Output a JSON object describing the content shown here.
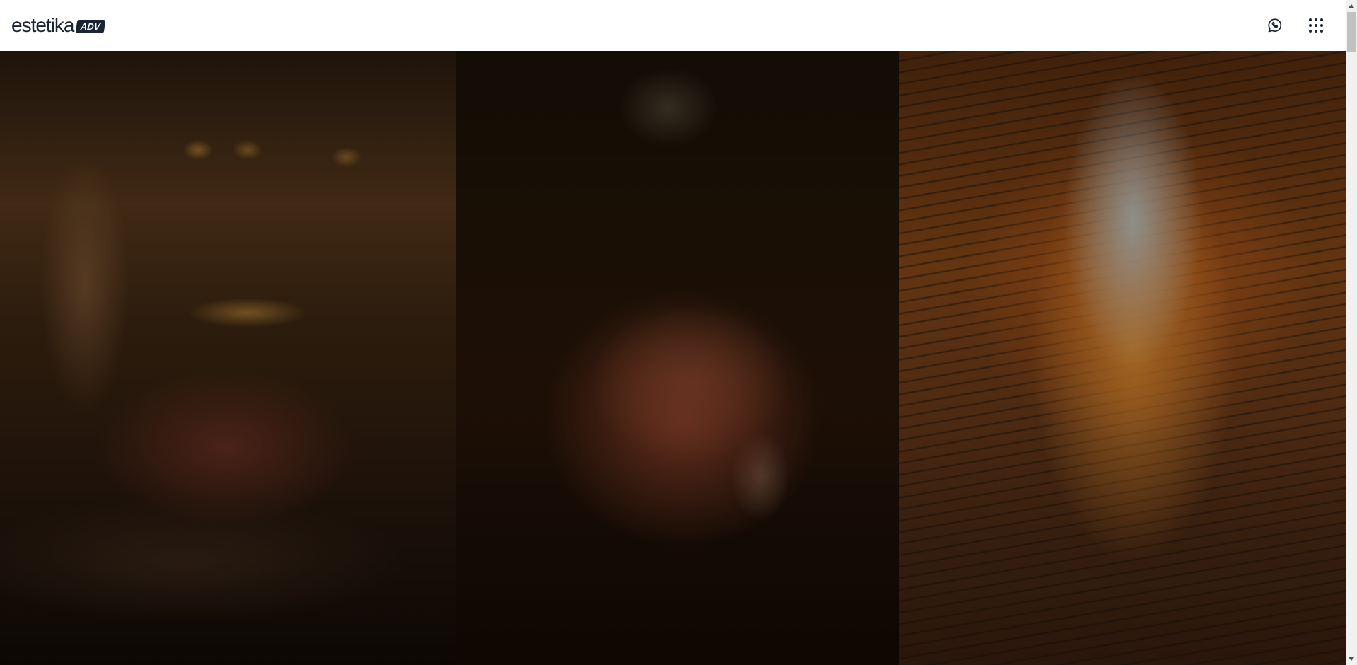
{
  "header": {
    "logo": {
      "wordmark": "estetika",
      "badge": "ADV"
    },
    "actions": [
      {
        "icon": "whatsapp-icon"
      },
      {
        "icon": "apps-grid-icon"
      }
    ]
  },
  "hero": {
    "panels": [
      {
        "subject": "searing-steak-in-pan"
      },
      {
        "subject": "seasoned-roast"
      },
      {
        "subject": "meat-flaming-on-grill"
      }
    ]
  },
  "colors": {
    "brand_dark": "#1a2433",
    "header_bg": "#ffffff",
    "scrollbar_track": "#f1f1f1",
    "scrollbar_thumb": "#c1c1c1"
  }
}
